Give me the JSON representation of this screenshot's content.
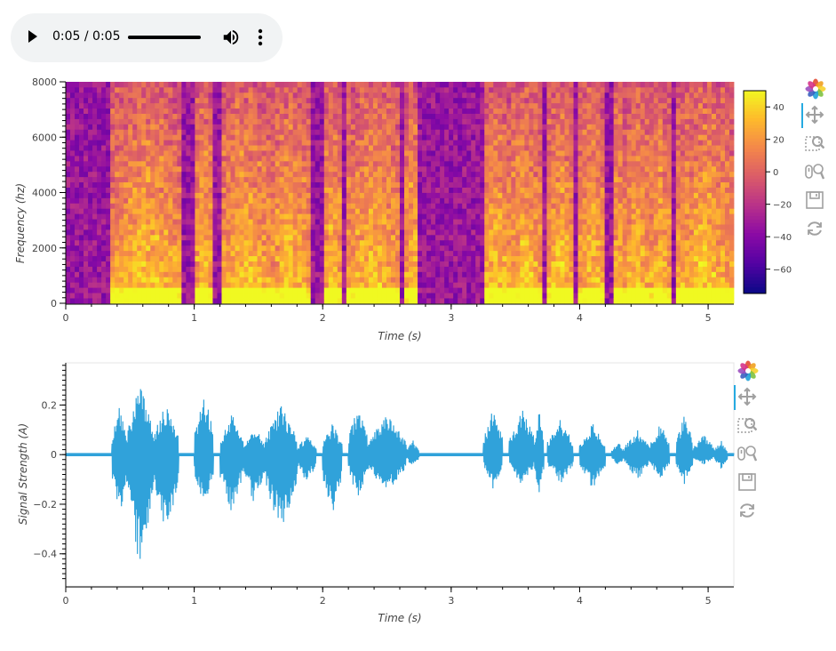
{
  "audio_player": {
    "time_display": "0:05 / 0:05",
    "progress": 1.0,
    "icons": {
      "play": "play-icon",
      "volume": "volume-icon",
      "menu": "more-vertical-icon"
    }
  },
  "toolbar": {
    "icons": [
      "bokeh-logo-icon",
      "pan-icon",
      "box-zoom-icon",
      "wheel-zoom-icon",
      "save-icon",
      "reset-icon"
    ],
    "colors": {
      "icon": "#a0a0a0",
      "active": "#26aae1"
    }
  },
  "colors": {
    "waveform": "#30a2da",
    "axis": "#000000"
  },
  "chart_data": [
    {
      "type": "heatmap",
      "title": "",
      "xlabel": "Time (s)",
      "ylabel": "Frequency (hz)",
      "xlim": [
        0,
        5.2
      ],
      "ylim": [
        0,
        8000
      ],
      "x_ticks": [
        "0",
        "1",
        "2",
        "3",
        "4",
        "5"
      ],
      "y_ticks": [
        "0",
        "2000",
        "4000",
        "6000",
        "8000"
      ],
      "colormap": "plasma",
      "colorbar": {
        "range": [
          -75,
          50
        ],
        "ticks": [
          "40",
          "20",
          "0",
          "−20",
          "−40",
          "−60"
        ],
        "tick_values": [
          40,
          20,
          0,
          -20,
          -40,
          -60
        ]
      },
      "high_energy_segments_s": [
        [
          0.36,
          0.9
        ],
        [
          1.0,
          1.15
        ],
        [
          1.2,
          1.6
        ],
        [
          1.6,
          1.9
        ],
        [
          2.0,
          2.15
        ],
        [
          2.2,
          2.6
        ],
        [
          2.65,
          2.75
        ],
        [
          3.25,
          3.45
        ],
        [
          3.45,
          3.7
        ],
        [
          3.75,
          3.95
        ],
        [
          4.0,
          4.2
        ],
        [
          4.25,
          4.35
        ],
        [
          4.35,
          4.55
        ],
        [
          4.55,
          4.7
        ],
        [
          4.75,
          5.2
        ]
      ]
    },
    {
      "type": "line",
      "title": "",
      "xlabel": "Time (s)",
      "ylabel": "Signal Strength (A)",
      "xlim": [
        0,
        5.2
      ],
      "ylim": [
        -0.53,
        0.37
      ],
      "x_ticks": [
        "0",
        "1",
        "2",
        "3",
        "4",
        "5"
      ],
      "y_ticks": [
        "0.2",
        "0",
        "−0.2",
        "−0.4"
      ],
      "y_tick_values": [
        0.2,
        0,
        -0.2,
        -0.4
      ],
      "envelope": [
        {
          "t0": 0.36,
          "t1": 0.48,
          "max": 0.2,
          "min": -0.27
        },
        {
          "t0": 0.48,
          "t1": 0.68,
          "max": 0.29,
          "min": -0.47
        },
        {
          "t0": 0.68,
          "t1": 0.88,
          "max": 0.21,
          "min": -0.32
        },
        {
          "t0": 1.0,
          "t1": 1.15,
          "max": 0.26,
          "min": -0.23
        },
        {
          "t0": 1.2,
          "t1": 1.38,
          "max": 0.17,
          "min": -0.25
        },
        {
          "t0": 1.38,
          "t1": 1.55,
          "max": 0.12,
          "min": -0.2
        },
        {
          "t0": 1.55,
          "t1": 1.8,
          "max": 0.2,
          "min": -0.32
        },
        {
          "t0": 1.8,
          "t1": 1.95,
          "max": 0.08,
          "min": -0.12
        },
        {
          "t0": 2.0,
          "t1": 2.15,
          "max": 0.13,
          "min": -0.26
        },
        {
          "t0": 2.2,
          "t1": 2.35,
          "max": 0.21,
          "min": -0.19
        },
        {
          "t0": 2.35,
          "t1": 2.65,
          "max": 0.16,
          "min": -0.16
        },
        {
          "t0": 2.65,
          "t1": 2.75,
          "max": 0.06,
          "min": -0.05
        },
        {
          "t0": 3.25,
          "t1": 3.4,
          "max": 0.19,
          "min": -0.14
        },
        {
          "t0": 3.45,
          "t1": 3.65,
          "max": 0.19,
          "min": -0.13
        },
        {
          "t0": 3.65,
          "t1": 3.72,
          "max": 0.19,
          "min": -0.17
        },
        {
          "t0": 3.75,
          "t1": 3.95,
          "max": 0.15,
          "min": -0.12
        },
        {
          "t0": 4.0,
          "t1": 4.2,
          "max": 0.13,
          "min": -0.14
        },
        {
          "t0": 4.25,
          "t1": 4.35,
          "max": 0.05,
          "min": -0.05
        },
        {
          "t0": 4.35,
          "t1": 4.55,
          "max": 0.1,
          "min": -0.1
        },
        {
          "t0": 4.55,
          "t1": 4.7,
          "max": 0.13,
          "min": -0.11
        },
        {
          "t0": 4.75,
          "t1": 4.88,
          "max": 0.17,
          "min": -0.12
        },
        {
          "t0": 4.88,
          "t1": 5.05,
          "max": 0.08,
          "min": -0.04
        },
        {
          "t0": 5.05,
          "t1": 5.15,
          "max": 0.06,
          "min": -0.06
        }
      ]
    }
  ]
}
